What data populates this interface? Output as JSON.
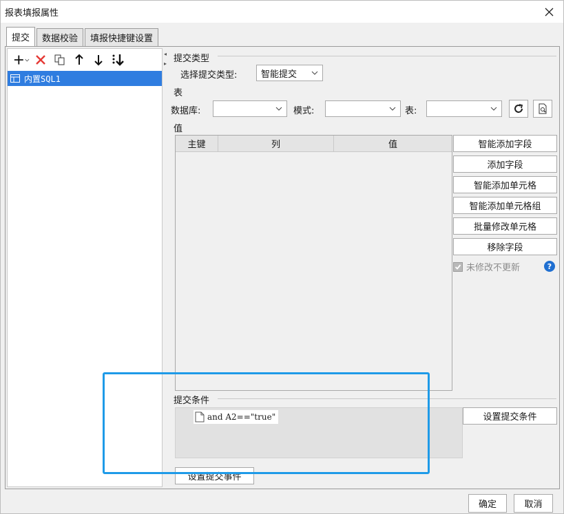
{
  "window": {
    "title": "报表填报属性"
  },
  "tabs": [
    {
      "label": "提交",
      "active": true
    },
    {
      "label": "数据校验"
    },
    {
      "label": "填报快捷键设置"
    }
  ],
  "left": {
    "toolbar": [
      "add-icon",
      "delete-icon",
      "copy-icon",
      "move-up-icon",
      "move-down-icon",
      "move-bottom-icon"
    ],
    "items": [
      {
        "label": "内置SQL1",
        "selected": true
      }
    ]
  },
  "submit_type": {
    "group_title": "提交类型",
    "select_label": "选择提交类型:",
    "selected": "智能提交"
  },
  "table_group": {
    "title": "表",
    "db_label": "数据库:",
    "db_value": "",
    "schema_label": "模式:",
    "schema_value": "",
    "table_label": "表:",
    "table_value": ""
  },
  "value_group": {
    "title": "值",
    "columns": [
      "主键",
      "列",
      "值"
    ],
    "rows": []
  },
  "side_buttons": [
    "智能添加字段",
    "添加字段",
    "智能添加单元格",
    "智能添加单元格组",
    "批量修改单元格",
    "移除字段"
  ],
  "checkbox": {
    "label": "未修改不更新",
    "checked": true,
    "enabled": false
  },
  "condition": {
    "title": "提交条件",
    "items": [
      "and A2==\"true\""
    ],
    "set_button": "设置提交条件"
  },
  "event_button": "设置提交事件",
  "footer": {
    "ok": "确定",
    "cancel": "取消"
  },
  "colors": {
    "selection": "#2f7de0",
    "highlight": "#1e9ae8",
    "delete": "#e53935",
    "help": "#1f6fd1"
  }
}
